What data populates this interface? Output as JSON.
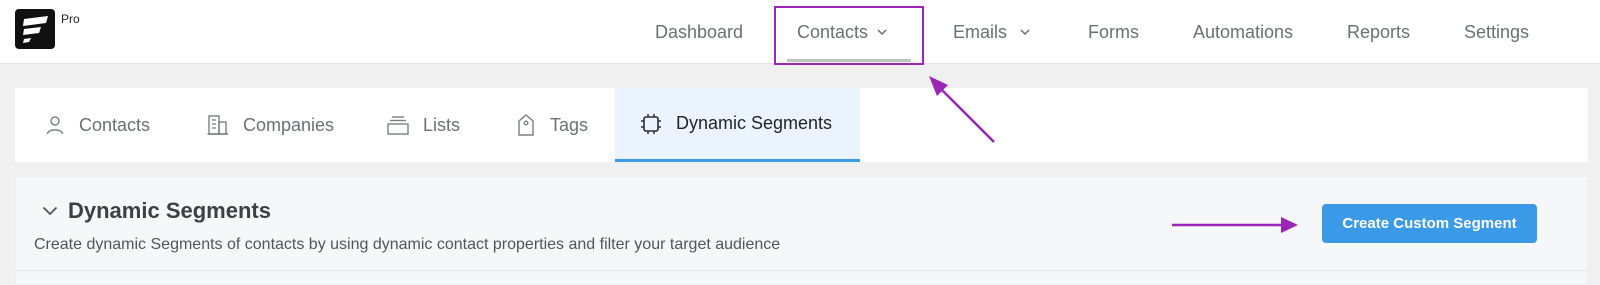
{
  "brand": {
    "badge": "Pro"
  },
  "nav": {
    "items": [
      {
        "label": "Dashboard"
      },
      {
        "label": "Contacts",
        "dropdown": true
      },
      {
        "label": "Emails",
        "dropdown": true
      },
      {
        "label": "Forms"
      },
      {
        "label": "Automations"
      },
      {
        "label": "Reports"
      },
      {
        "label": "Settings"
      }
    ]
  },
  "subtabs": {
    "items": [
      {
        "label": "Contacts",
        "icon": "user-icon"
      },
      {
        "label": "Companies",
        "icon": "building-icon"
      },
      {
        "label": "Lists",
        "icon": "stack-icon"
      },
      {
        "label": "Tags",
        "icon": "tag-icon"
      },
      {
        "label": "Dynamic Segments",
        "icon": "chip-icon",
        "active": true
      }
    ]
  },
  "segments": {
    "title": "Dynamic Segments",
    "description": "Create dynamic Segments of contacts by using dynamic contact properties and filter your target audience",
    "create_button": "Create Custom Segment"
  },
  "colors": {
    "accent": "#3b9ae8",
    "annotation": "#9b25b6",
    "active_tab_bg": "#ebf3fe"
  }
}
